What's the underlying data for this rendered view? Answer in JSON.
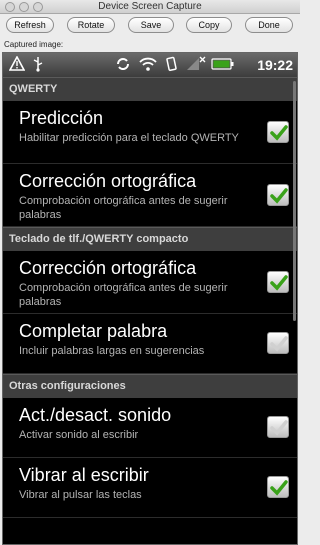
{
  "window": {
    "title": "Device Screen Capture"
  },
  "toolbar": {
    "refresh": "Refresh",
    "rotate": "Rotate",
    "save": "Save",
    "copy": "Copy",
    "done": "Done"
  },
  "captured_label": "Captured image:",
  "statusbar": {
    "time": "19:22",
    "icons": [
      "warning-icon",
      "usb-icon",
      "sync-icon",
      "wifi-icon",
      "vibrate-icon",
      "no-signal-icon",
      "battery-icon"
    ]
  },
  "sections": [
    {
      "header": "QWERTY",
      "items": [
        {
          "title": "Predicción",
          "summary": "Habilitar predicción para el teclado QWERTY",
          "checked": true
        },
        {
          "title": "Corrección ortográfica",
          "summary": "Comprobación ortográfica antes de sugerir palabras",
          "checked": true
        }
      ]
    },
    {
      "header": "Teclado de tlf./QWERTY compacto",
      "items": [
        {
          "title": "Corrección ortográfica",
          "summary": "Comprobación ortográfica antes de sugerir palabras",
          "checked": true
        },
        {
          "title": "Completar palabra",
          "summary": "Incluir palabras largas en sugerencias",
          "checked": false
        }
      ]
    },
    {
      "header": "Otras configuraciones",
      "items": [
        {
          "title": "Act./desact. sonido",
          "summary": "Activar sonido al escribir",
          "checked": false
        },
        {
          "title": "Vibrar al escribir",
          "summary": "Vibrar al pulsar las teclas",
          "checked": true
        }
      ]
    }
  ],
  "colors": {
    "check_green": "#3aa21a",
    "section_bg": "#3e3e3e",
    "screen_bg": "#000000"
  }
}
